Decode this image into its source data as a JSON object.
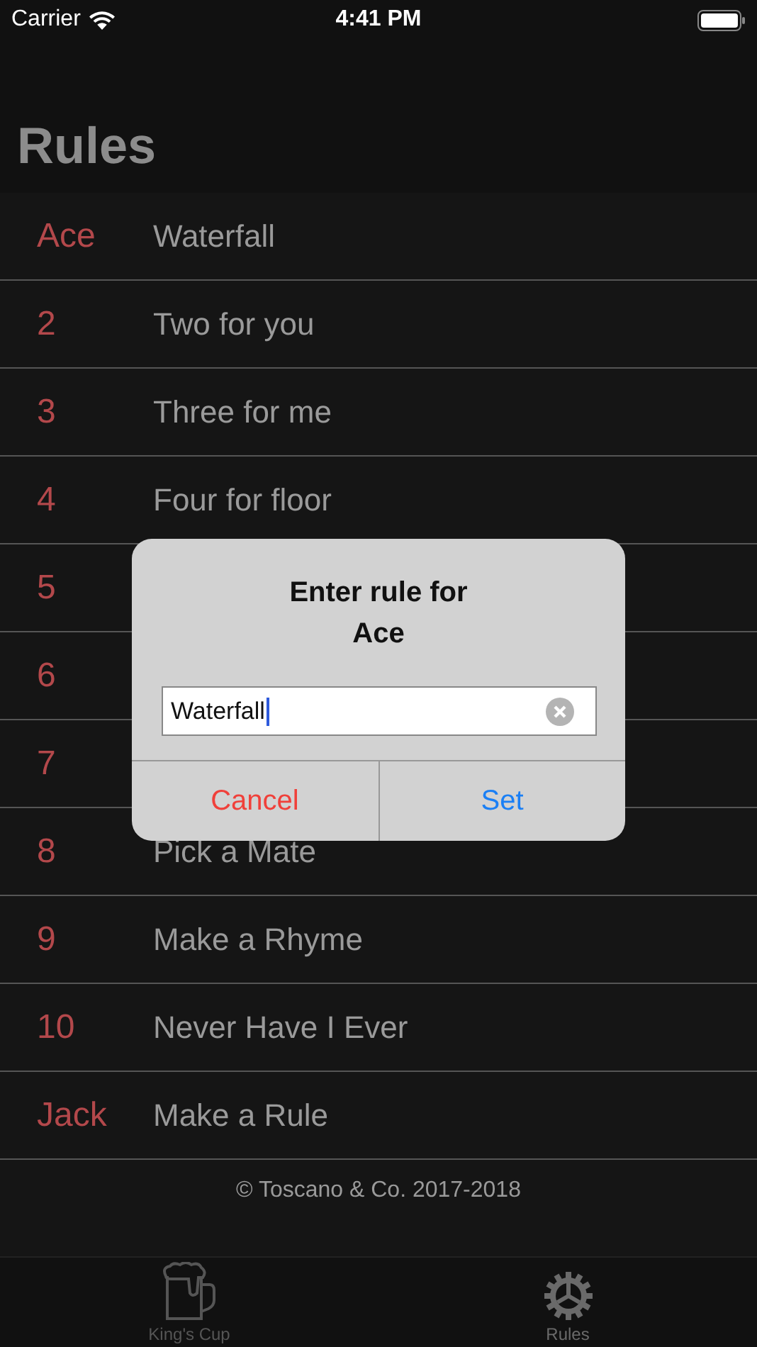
{
  "status_bar": {
    "carrier": "Carrier",
    "time": "4:41 PM"
  },
  "title": "Rules",
  "rules": [
    {
      "card": "Ace",
      "rule": "Waterfall"
    },
    {
      "card": "2",
      "rule": "Two for you"
    },
    {
      "card": "3",
      "rule": "Three for me"
    },
    {
      "card": "4",
      "rule": "Four for floor"
    },
    {
      "card": "5"
    },
    {
      "card": "6"
    },
    {
      "card": "7"
    },
    {
      "card": "8",
      "rule": "Pick a Mate"
    },
    {
      "card": "9",
      "rule": "Make a Rhyme"
    },
    {
      "card": "10",
      "rule": "Never Have I Ever"
    },
    {
      "card": "Jack",
      "rule": "Make a Rule"
    }
  ],
  "footer": "© Toscano & Co. 2017-2018",
  "alert": {
    "title": "Enter rule for",
    "subject": "Ace",
    "field_value": "Waterfall",
    "buttons": [
      {
        "label": "Cancel",
        "kind": "destructive"
      },
      {
        "label": "Set",
        "kind": "default"
      }
    ]
  },
  "tabs": [
    {
      "label": "King's Cup",
      "selected": false
    },
    {
      "label": "Rules",
      "selected": true
    }
  ]
}
